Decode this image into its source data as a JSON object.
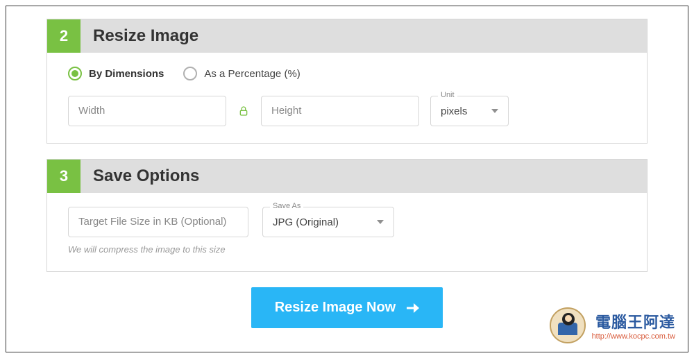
{
  "step2": {
    "number": "2",
    "title": "Resize Image",
    "radio": {
      "dimensions": "By Dimensions",
      "percentage": "As a Percentage (%)"
    },
    "width_placeholder": "Width",
    "height_placeholder": "Height",
    "unit_label": "Unit",
    "unit_value": "pixels"
  },
  "step3": {
    "number": "3",
    "title": "Save Options",
    "filesize_placeholder": "Target File Size in KB (Optional)",
    "saveas_label": "Save As",
    "saveas_value": "JPG (Original)",
    "hint": "We will compress the image to this size"
  },
  "cta": {
    "label": "Resize Image Now"
  },
  "watermark": {
    "title": "電腦王阿達",
    "url": "http://www.kocpc.com.tw"
  }
}
